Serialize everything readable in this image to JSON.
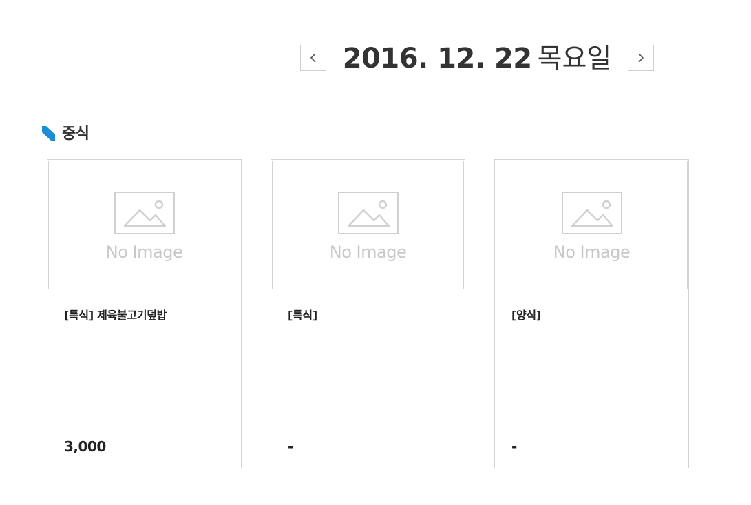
{
  "date_nav": {
    "date": "2016. 12. 22",
    "weekday": "목요일",
    "prev_icon": "chevron-left-icon",
    "next_icon": "chevron-right-icon"
  },
  "section": {
    "title": "중식",
    "bullet_color": "#1a8fd8"
  },
  "cards": [
    {
      "image_label": "No Image",
      "title": "[특식] 제육불고기덮밥",
      "price": "3,000"
    },
    {
      "image_label": "No Image",
      "title": "[특식]",
      "price": "-"
    },
    {
      "image_label": "No Image",
      "title": "[양식]",
      "price": "-"
    }
  ]
}
